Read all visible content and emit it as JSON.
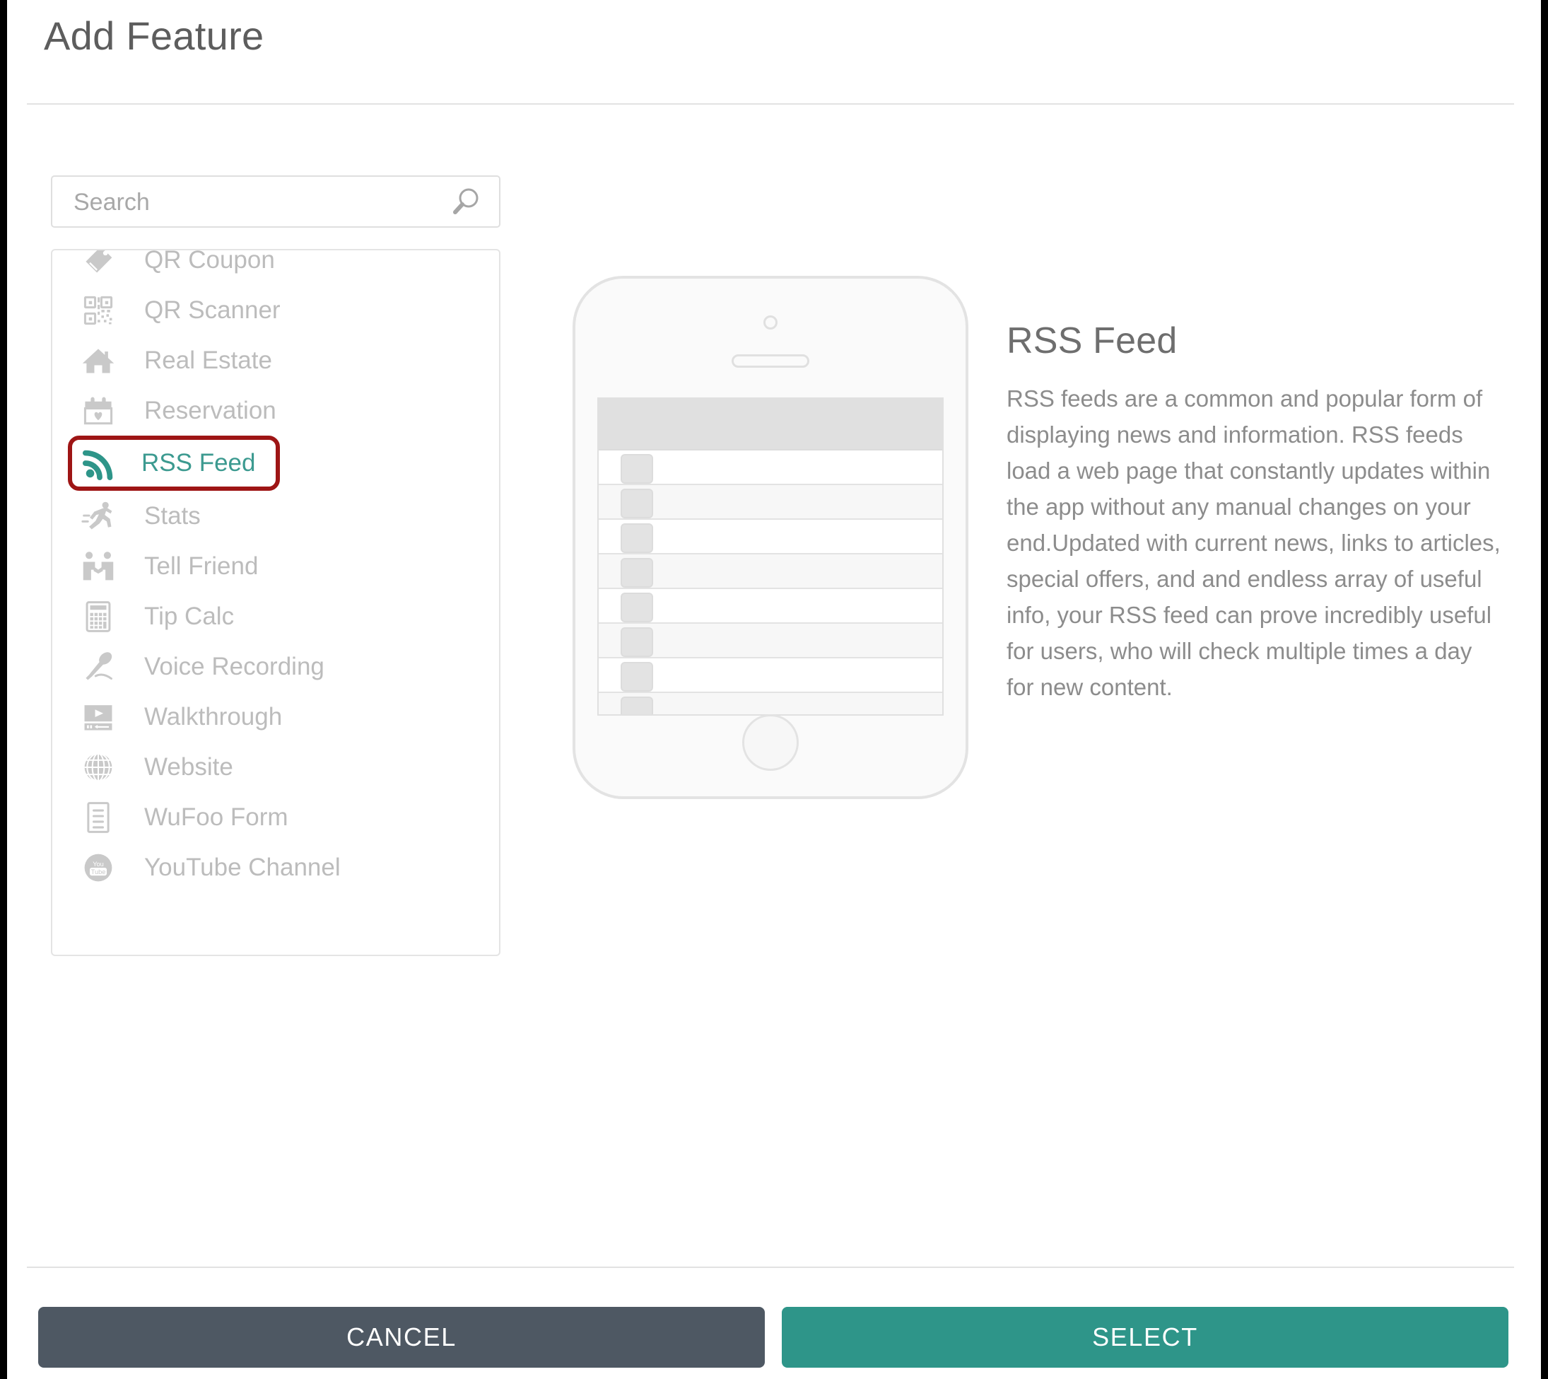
{
  "header": {
    "title": "Add Feature"
  },
  "search": {
    "placeholder": "Search",
    "value": "",
    "icon": "search-icon"
  },
  "feature_list": {
    "selected": "RSS Feed",
    "items": [
      {
        "label": "QR Coupon",
        "icon": "tag-icon"
      },
      {
        "label": "QR Scanner",
        "icon": "qr-code-icon"
      },
      {
        "label": "Real Estate",
        "icon": "home-icon"
      },
      {
        "label": "Reservation",
        "icon": "calendar-heart-icon"
      },
      {
        "label": "RSS Feed",
        "icon": "rss-icon"
      },
      {
        "label": "Stats",
        "icon": "runner-icon"
      },
      {
        "label": "Tell Friend",
        "icon": "two-people-icon"
      },
      {
        "label": "Tip Calc",
        "icon": "calculator-icon"
      },
      {
        "label": "Voice Recording",
        "icon": "microphone-icon"
      },
      {
        "label": "Walkthrough",
        "icon": "video-player-icon"
      },
      {
        "label": "Website",
        "icon": "globe-icon"
      },
      {
        "label": "WuFoo Form",
        "icon": "document-lines-icon"
      },
      {
        "label": "YouTube Channel",
        "icon": "youtube-icon"
      }
    ]
  },
  "preview": {
    "device": "phone-mockup",
    "rows": 8
  },
  "detail": {
    "title": "RSS Feed",
    "description": "RSS feeds are a common and popular form of displaying news and information. RSS feeds load a web page that constantly updates within the app without any manual changes on your end.Updated with current news, links to articles, special offers, and and endless array of useful info, your RSS feed can prove incredibly useful for users, who will check multiple times a day for new content."
  },
  "footer": {
    "cancel_label": "CANCEL",
    "select_label": "SELECT"
  },
  "colors": {
    "accent_teal": "#2e9589",
    "selected_text": "#3c9a90",
    "highlight_border": "#9e1515",
    "cancel_bg": "#4e5863",
    "muted_text": "#bcbcbc"
  }
}
